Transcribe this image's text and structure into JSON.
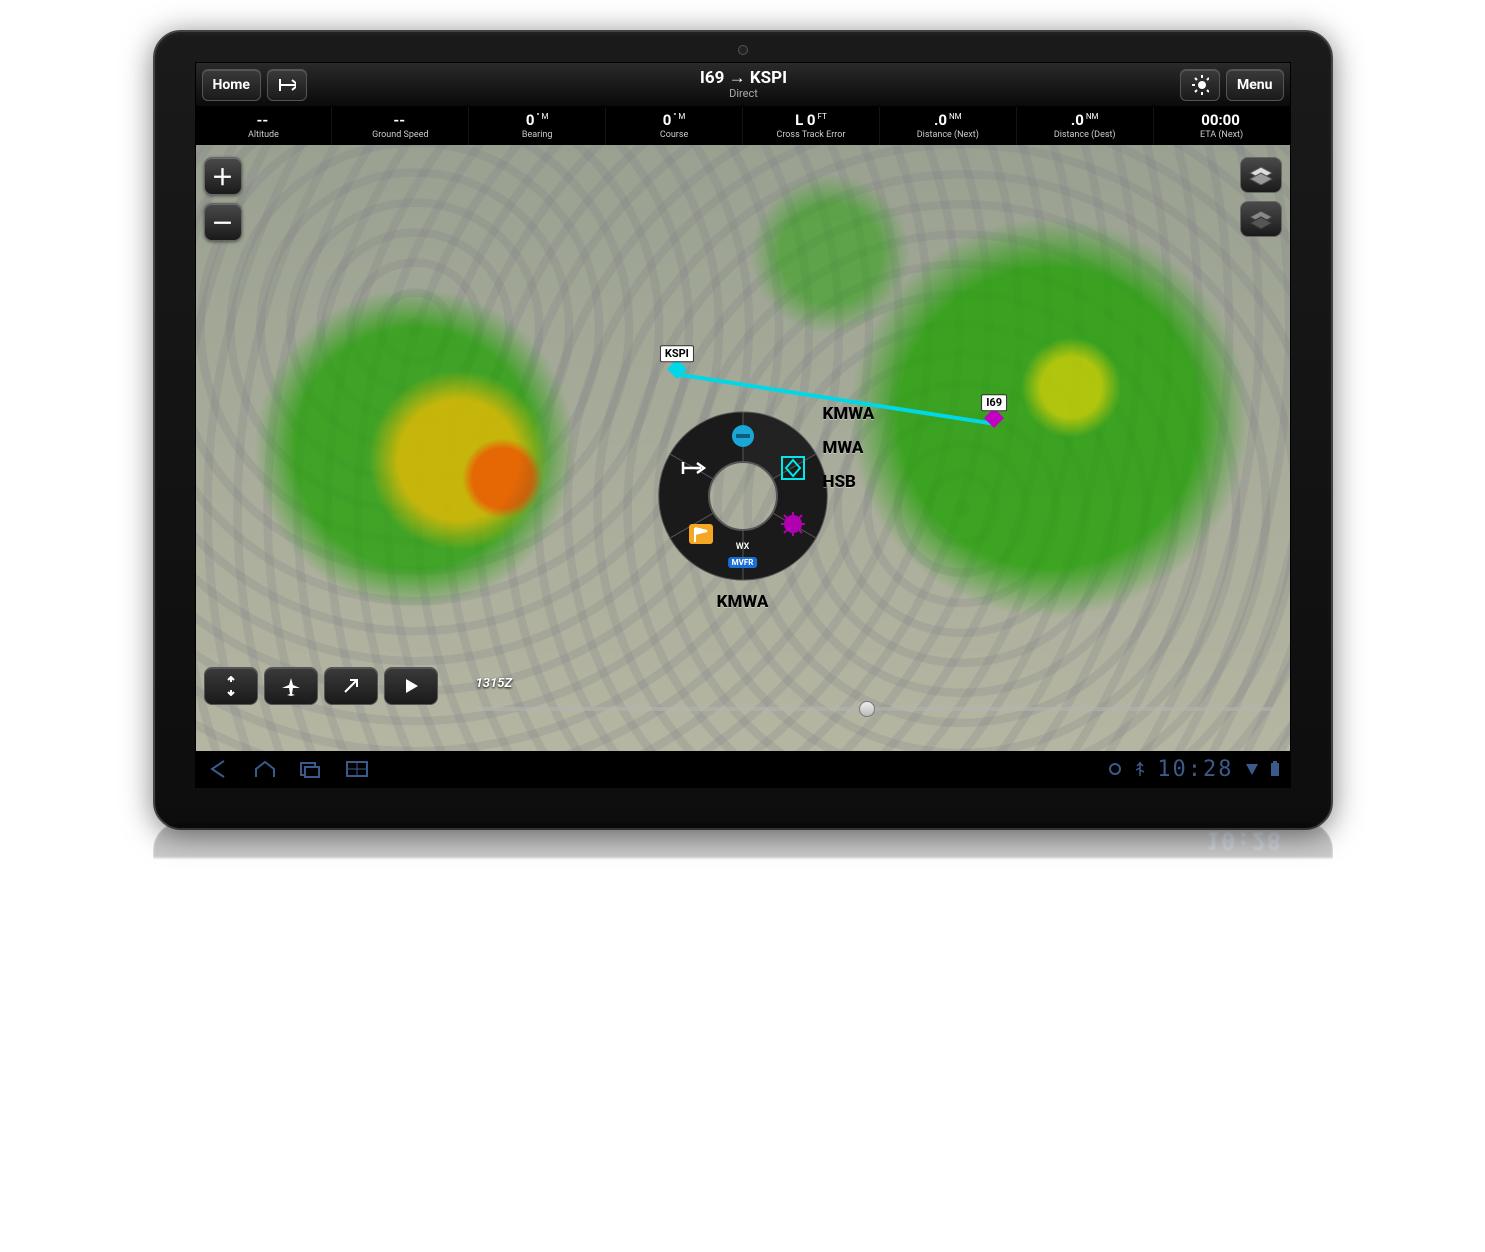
{
  "header": {
    "home_label": "Home",
    "menu_label": "Menu",
    "route_title": "I69 → KSPI",
    "route_subtitle": "Direct"
  },
  "datastrip": [
    {
      "value": "--",
      "unit": "",
      "label": "Altitude"
    },
    {
      "value": "--",
      "unit": "",
      "label": "Ground Speed"
    },
    {
      "value": "0",
      "unit": "° M",
      "label": "Bearing"
    },
    {
      "value": "0",
      "unit": "° M",
      "label": "Course"
    },
    {
      "value": "L 0",
      "unit": "FT",
      "label": "Cross Track Error"
    },
    {
      "value": ".0",
      "unit": "NM",
      "label": "Distance (Next)"
    },
    {
      "value": ".0",
      "unit": "NM",
      "label": "Distance (Dest)"
    },
    {
      "value": "00:00",
      "unit": "",
      "label": "ETA (Next)"
    }
  ],
  "waypoints": {
    "dest": "KSPI",
    "origin": "I69"
  },
  "radial": {
    "labels": [
      "KMWA",
      "MWA",
      "HSB"
    ],
    "bottom_label": "KMWA",
    "wx_label": "WX",
    "wx_badge": "MVFR"
  },
  "timeline": {
    "timestamp": "1315Z"
  },
  "system": {
    "clock": "10:28"
  }
}
